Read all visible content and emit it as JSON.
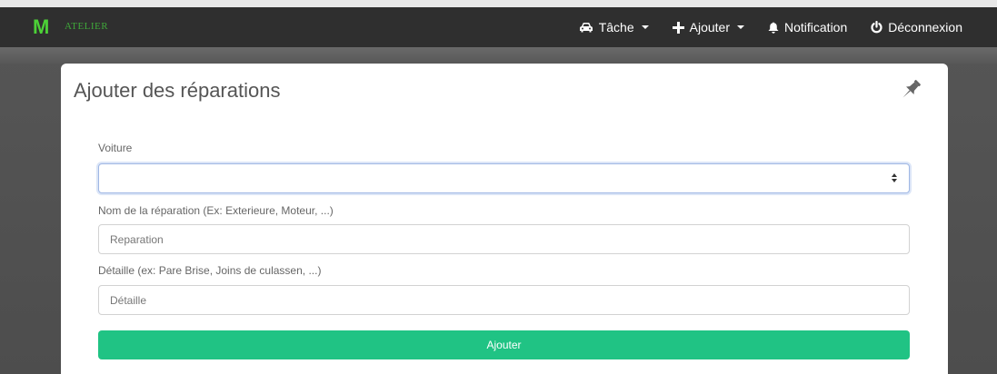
{
  "brand": {
    "letter": "M",
    "name": "ATELIER"
  },
  "nav": {
    "tache": "Tâche",
    "ajouter": "Ajouter",
    "notification": "Notification",
    "deconnexion": "Déconnexion"
  },
  "card": {
    "title": "Ajouter des réparations"
  },
  "form": {
    "voiture_label": "Voiture",
    "voiture_value": "",
    "nom_label": "Nom de la réparation (Ex: Exterieure, Moteur, ...)",
    "nom_placeholder": "Reparation",
    "detail_label": "Détaille (ex: Pare Brise, Joins de culassen, ...)",
    "detail_placeholder": "Détaille",
    "submit_label": "Ajouter"
  },
  "colors": {
    "brand_green": "#4cd137",
    "submit_green": "#20c384",
    "navbar": "#2f2f2f"
  },
  "icons": [
    "car-icon",
    "plus-icon",
    "bell-icon",
    "power-icon",
    "pin-icon"
  ]
}
